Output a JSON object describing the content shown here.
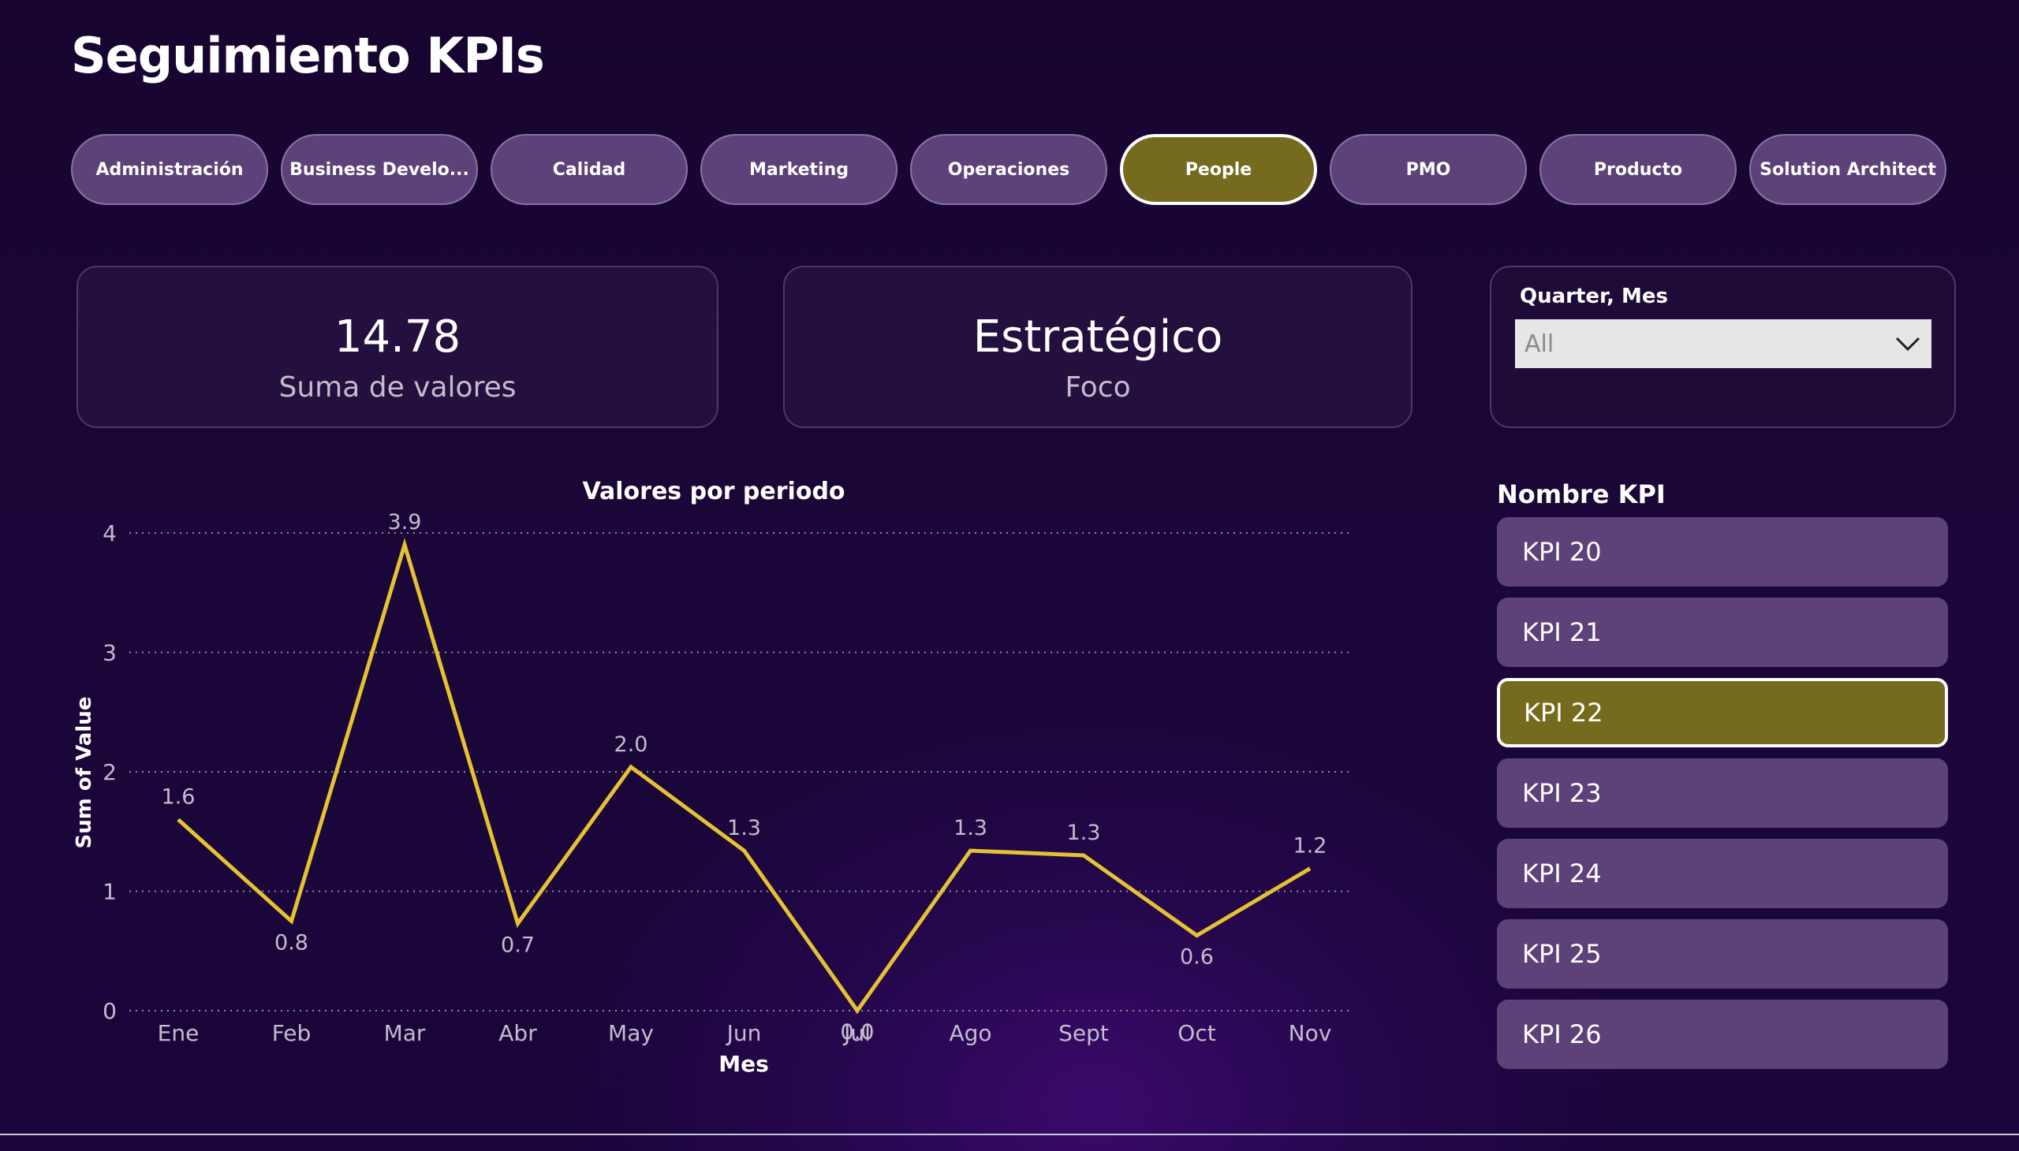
{
  "title": "Seguimiento KPIs",
  "tabs": [
    {
      "label": "Administración",
      "active": false
    },
    {
      "label": "Business Develo...",
      "active": false
    },
    {
      "label": "Calidad",
      "active": false
    },
    {
      "label": "Marketing",
      "active": false
    },
    {
      "label": "Operaciones",
      "active": false
    },
    {
      "label": "People",
      "active": true
    },
    {
      "label": "PMO",
      "active": false
    },
    {
      "label": "Producto",
      "active": false
    },
    {
      "label": "Solution Architect",
      "active": false
    }
  ],
  "cards": {
    "sum": {
      "value": "14.78",
      "label": "Suma de valores"
    },
    "focus": {
      "value": "Estratégico",
      "label": "Foco"
    }
  },
  "slicer": {
    "title": "Quarter, Mes",
    "selected": "All"
  },
  "kpi_list": {
    "title": "Nombre KPI",
    "items": [
      "KPI 20",
      "KPI 21",
      "KPI 22",
      "KPI 23",
      "KPI 24",
      "KPI 25",
      "KPI 26"
    ],
    "selected": "KPI 22"
  },
  "colors": {
    "line": "#e5c232",
    "tab": "#5c4278",
    "tab_active": "#756a1e",
    "grid": "#8e8ea4"
  },
  "chart_data": {
    "type": "line",
    "title": "Valores por periodo",
    "xlabel": "Mes",
    "ylabel": "Sum of Value",
    "categories": [
      "Ene",
      "Feb",
      "Mar",
      "Abr",
      "May",
      "Jun",
      "Jul",
      "Ago",
      "Sept",
      "Oct",
      "Nov"
    ],
    "values": [
      1.6,
      0.75,
      3.9,
      0.73,
      2.04,
      1.34,
      0.0,
      1.34,
      1.3,
      0.63,
      1.19
    ],
    "data_labels": [
      "1.6",
      "0.8",
      "3.9",
      "0.7",
      "2.0",
      "1.3",
      "0.0",
      "1.3",
      "1.3",
      "0.6",
      "1.2"
    ],
    "yticks": [
      0,
      1,
      2,
      3,
      4
    ],
    "ylim": [
      0,
      4
    ],
    "grid": true
  }
}
